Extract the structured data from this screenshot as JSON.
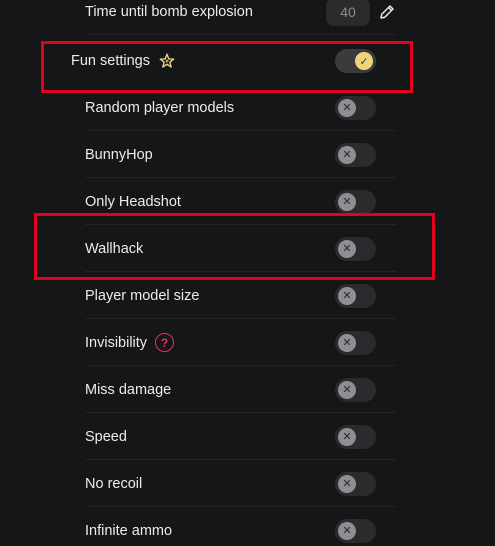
{
  "bomb_timer": {
    "label": "Time until bomb explosion",
    "value": "40"
  },
  "fun": {
    "label": "Fun settings",
    "toggle_glyph": "✓"
  },
  "settings": [
    {
      "label": "Random player models",
      "glyph": "✕"
    },
    {
      "label": "BunnyHop",
      "glyph": "✕"
    },
    {
      "label": "Only Headshot",
      "glyph": "✕"
    },
    {
      "label": "Wallhack",
      "glyph": "✕"
    },
    {
      "label": "Player model size",
      "glyph": "✕"
    },
    {
      "label": "Invisibility",
      "glyph": "✕",
      "help": "?"
    },
    {
      "label": "Miss damage",
      "glyph": "✕"
    },
    {
      "label": "Speed",
      "glyph": "✕"
    },
    {
      "label": "No recoil",
      "glyph": "✕"
    },
    {
      "label": "Infinite ammo",
      "glyph": "✕"
    }
  ],
  "colors": {
    "highlight": "#e5001d",
    "toggle_on": "#f2d37a",
    "help": "#e0345a"
  }
}
